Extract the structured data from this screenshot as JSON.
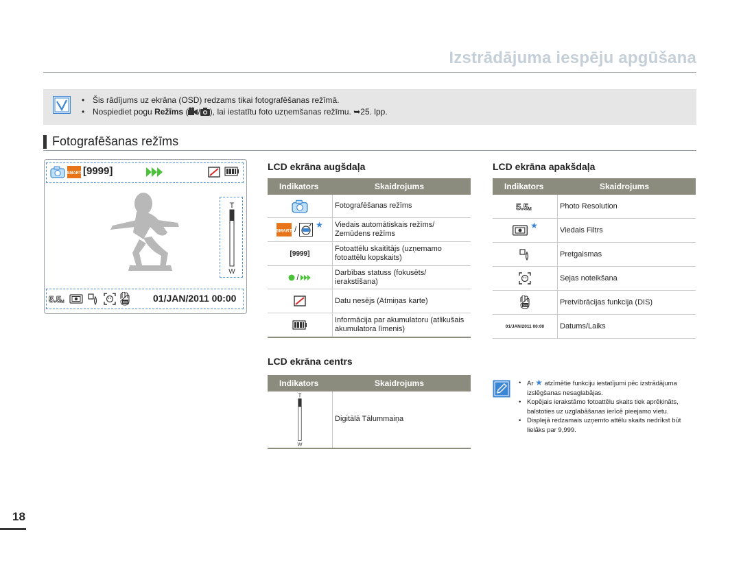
{
  "header": {
    "title": "Izstrādājuma iespēju apgūšana"
  },
  "note": {
    "line1": "Šis rādījums uz ekrāna (OSD) redzams tikai fotografēšanas režīmā.",
    "line2_pre": "Nospiediet pogu ",
    "line2_bold": "Režīms",
    "line2_mid1": " (",
    "line2_mid2": "/",
    "line2_post": "), lai iestatītu foto uzņemšanas režīmu. ",
    "line2_ref": "➥25. lpp."
  },
  "section": {
    "title": "Fotografēšanas režīms"
  },
  "lcd": {
    "count": "[9999]",
    "datetime": "01/JAN/2011 00:00"
  },
  "lcd_top": {
    "title": "LCD ekrāna augšdaļa",
    "col_indicator": "Indikators",
    "col_desc": "Skaidrojums",
    "rows": [
      {
        "icon": "camera-mode-icon",
        "desc": "Fotografēšanas režīms"
      },
      {
        "icon": "smart-auto-underwater-icon",
        "sep": "/",
        "desc": "Viedais automātiskais režīms/ Zemūdens režīms"
      },
      {
        "icon": "photo-counter",
        "label": "[9999]",
        "desc": "Fotoattēlu skaitītājs (uzņemamo fotoattēlu kopskaits)"
      },
      {
        "icon": "focus-record-status-icon",
        "sep": "/",
        "desc": "Darbības statuss (fokusēts/ ierakstīšana)"
      },
      {
        "icon": "no-storage-icon",
        "desc": "Datu nesējs (Atmiņas karte)"
      },
      {
        "icon": "battery-icon",
        "desc": "Informācija par akumulatoru (atlikušais akumulatora līmenis)"
      }
    ]
  },
  "lcd_bottom": {
    "title": "LCD ekrāna apakšdaļa",
    "col_indicator": "Indikators",
    "col_desc": "Skaidrojums",
    "rows": [
      {
        "icon": "photo-resolution-icon",
        "desc": "Photo Resolution"
      },
      {
        "icon": "smart-filter-icon",
        "desc": "Viedais Filtrs"
      },
      {
        "icon": "backlight-icon",
        "desc": "Pretgaismas"
      },
      {
        "icon": "face-detection-icon",
        "desc": "Sejas noteikšana"
      },
      {
        "icon": "dis-icon",
        "desc": "Pretvibrācijas funkcija (DIS)"
      },
      {
        "icon": "date-time",
        "label": "01/JAN/2011 00:00",
        "desc": "Datums/Laiks"
      }
    ]
  },
  "lcd_center": {
    "title": "LCD ekrāna centrs",
    "col_indicator": "Indikators",
    "col_desc": "Skaidrojums",
    "rows": [
      {
        "icon": "zoom-bar-icon",
        "desc": "Digitālā Tālummaiņa"
      }
    ]
  },
  "side_note": {
    "item1_pre": "Ar ",
    "item1_post": " atzīmētie funkciju iestatījumi pēc izstrādājuma izslēgšanas nesaglabājas.",
    "item2": "Kopējais ierakstāmo fotoattēlu skaits tiek aprēķināts, balstoties uz uzglabāšanas ierīcē pieejamo vietu.",
    "item3": "Displejā redzamais uzņemto attēlu skaits nedrīkst būt lielāks par 9,999."
  },
  "page": {
    "number": "18"
  },
  "colors": {
    "accent_blue": "#3a86d4",
    "table_head": "#8c8c7e",
    "title_gray": "#c5cfd8",
    "note_bg": "#e6e6e6"
  }
}
